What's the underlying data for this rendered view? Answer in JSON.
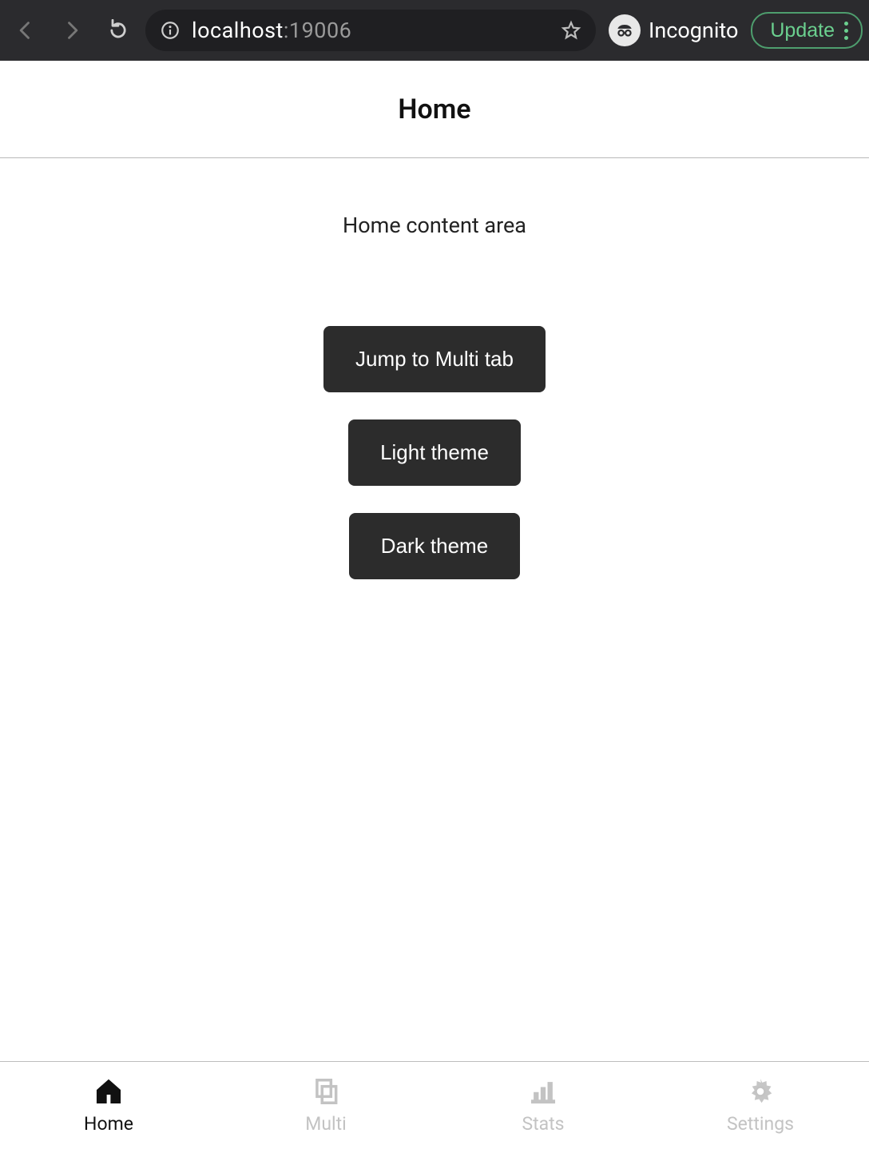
{
  "browser": {
    "url_host": "localhost",
    "url_port": ":19006",
    "incognito_label": "Incognito",
    "update_label": "Update"
  },
  "app": {
    "header_title": "Home",
    "content_text": "Home content area",
    "buttons": {
      "jump_multi": "Jump to Multi tab",
      "light_theme": "Light theme",
      "dark_theme": "Dark theme"
    }
  },
  "bottom_nav": {
    "items": [
      {
        "label": "Home",
        "active": true
      },
      {
        "label": "Multi",
        "active": false
      },
      {
        "label": "Stats",
        "active": false
      },
      {
        "label": "Settings",
        "active": false
      }
    ]
  }
}
